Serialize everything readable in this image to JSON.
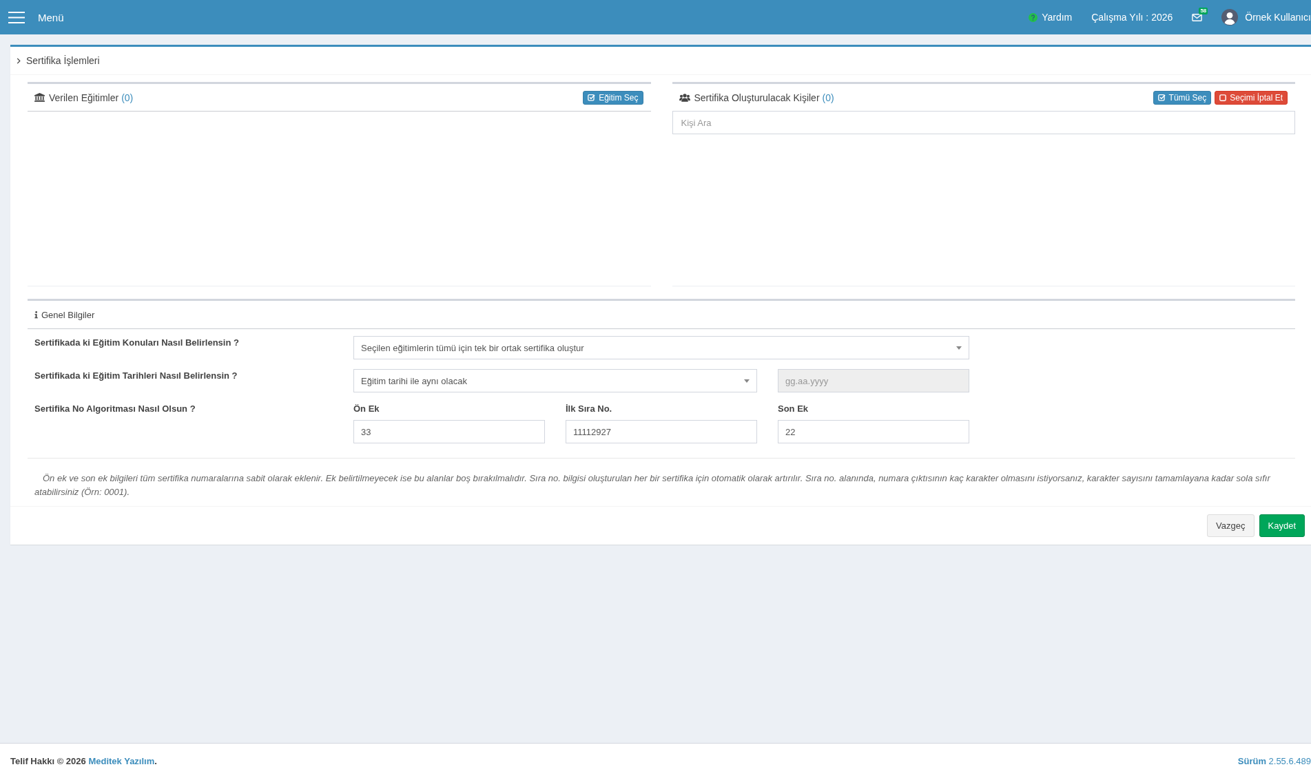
{
  "header": {
    "menu_label": "Menü",
    "help_label": "Yardım",
    "work_year": "Çalışma Yılı : 2026",
    "mail_badge": "58",
    "user_name": "Örnek Kullanıcı"
  },
  "page": {
    "title": "Sertifika İşlemleri",
    "panels": [
      {
        "kind": "trainings",
        "title": "Verilen Eğitimler",
        "count": "(0)",
        "buttons": [
          {
            "kind": "select",
            "label": "Eğitim Seç"
          }
        ]
      },
      {
        "kind": "people",
        "title": "Sertifika Oluşturulacak Kişiler",
        "count": "(0)",
        "buttons": [
          {
            "kind": "select_all",
            "label": "Tümü Seç"
          },
          {
            "kind": "clear",
            "label": "Seçimi İptal Et"
          }
        ],
        "search": {
          "placeholder": "Kişi Ara"
        }
      }
    ],
    "general": {
      "title": "Genel Bilgiler",
      "rows": [
        {
          "label": "Sertifikada ki Eğitim Konuları Nasıl Belirlensin ?",
          "fields": [
            {
              "kind": "select",
              "value": "Seçilen eğitimlerin tümü için tek bir ortak sertifika oluştur"
            }
          ]
        },
        {
          "label": "Sertifikada ki Eğitim Tarihleri Nasıl Belirlensin ?",
          "fields": [
            {
              "kind": "select",
              "value": "Eğitim tarihi ile aynı olacak"
            },
            {
              "kind": "date",
              "placeholder": "gg.aa.yyyy",
              "disabled": true
            }
          ]
        },
        {
          "label": "Sertifika No Algoritması Nasıl Olsun ?",
          "fields": [
            {
              "kind": "text",
              "caption": "Ön Ek",
              "value": "33"
            },
            {
              "kind": "text",
              "caption": "İlk Sıra No.",
              "value": "11112927"
            },
            {
              "kind": "text",
              "caption": "Son Ek",
              "value": "22"
            }
          ]
        }
      ]
    },
    "note": "Ön ek ve son ek bilgileri tüm sertifika numaralarına sabit olarak eklenir. Ek belirtilmeyecek ise bu alanlar boş bırakılmalıdır. Sıra no. bilgisi oluşturulan her bir sertifika için otomatik olarak artırılır. Sıra no. alanında, numara çıktısının kaç karakter olmasını istiyorsanız, karakter sayısını tamamlayana kadar sola sıfır atabilirsiniz (Örn: 0001).",
    "actions": [
      {
        "kind": "cancel",
        "label": "Vazgeç"
      },
      {
        "kind": "save",
        "label": "Kaydet"
      }
    ]
  },
  "footer": {
    "copyright": "Telif Hakkı © 2026",
    "company": "Meditek Yazılım",
    "copyright_end": ".",
    "version": "**Sürüm** 2.55.6.489"
  }
}
